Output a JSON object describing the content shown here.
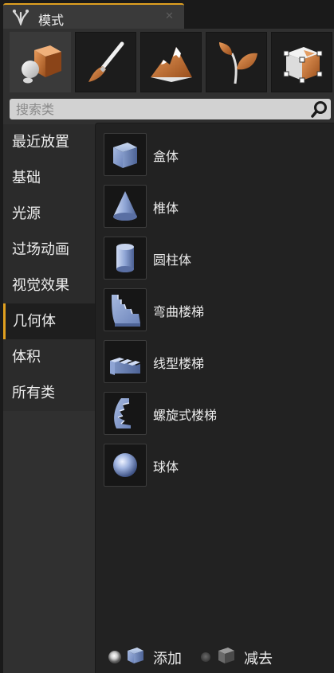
{
  "tab": {
    "title": "模式",
    "close_glyph": "✕",
    "icon": "modes-icon"
  },
  "modes": [
    {
      "name": "place-mode",
      "icon": "place-icon",
      "active": true
    },
    {
      "name": "paint-mode",
      "icon": "brush-icon",
      "active": false
    },
    {
      "name": "landscape-mode",
      "icon": "mountain-icon",
      "active": false
    },
    {
      "name": "foliage-mode",
      "icon": "leaf-icon",
      "active": false
    },
    {
      "name": "geometry-edit-mode",
      "icon": "geometry-cube-icon",
      "active": false
    }
  ],
  "search": {
    "placeholder": "搜索类",
    "value": ""
  },
  "categories": [
    {
      "label": "最近放置",
      "selected": false
    },
    {
      "label": "基础",
      "selected": false
    },
    {
      "label": "光源",
      "selected": false
    },
    {
      "label": "过场动画",
      "selected": false
    },
    {
      "label": "视觉效果",
      "selected": false
    },
    {
      "label": "几何体",
      "selected": true
    },
    {
      "label": "体积",
      "selected": false
    },
    {
      "label": "所有类",
      "selected": false
    }
  ],
  "items": [
    {
      "label": "盒体",
      "icon": "box-icon"
    },
    {
      "label": "椎体",
      "icon": "cone-icon"
    },
    {
      "label": "圆柱体",
      "icon": "cylinder-icon"
    },
    {
      "label": "弯曲楼梯",
      "icon": "curved-stairs-icon"
    },
    {
      "label": "线型楼梯",
      "icon": "linear-stairs-icon"
    },
    {
      "label": "螺旋式楼梯",
      "icon": "spiral-stairs-icon"
    },
    {
      "label": "球体",
      "icon": "sphere-icon"
    }
  ],
  "brush_type": {
    "add_label": "添加",
    "subtract_label": "减去",
    "selected": "add"
  },
  "colors": {
    "accent": "#e0a020",
    "panel_bg": "#303030",
    "list_bg": "#222222",
    "search_bg": "#d2d2d2"
  }
}
